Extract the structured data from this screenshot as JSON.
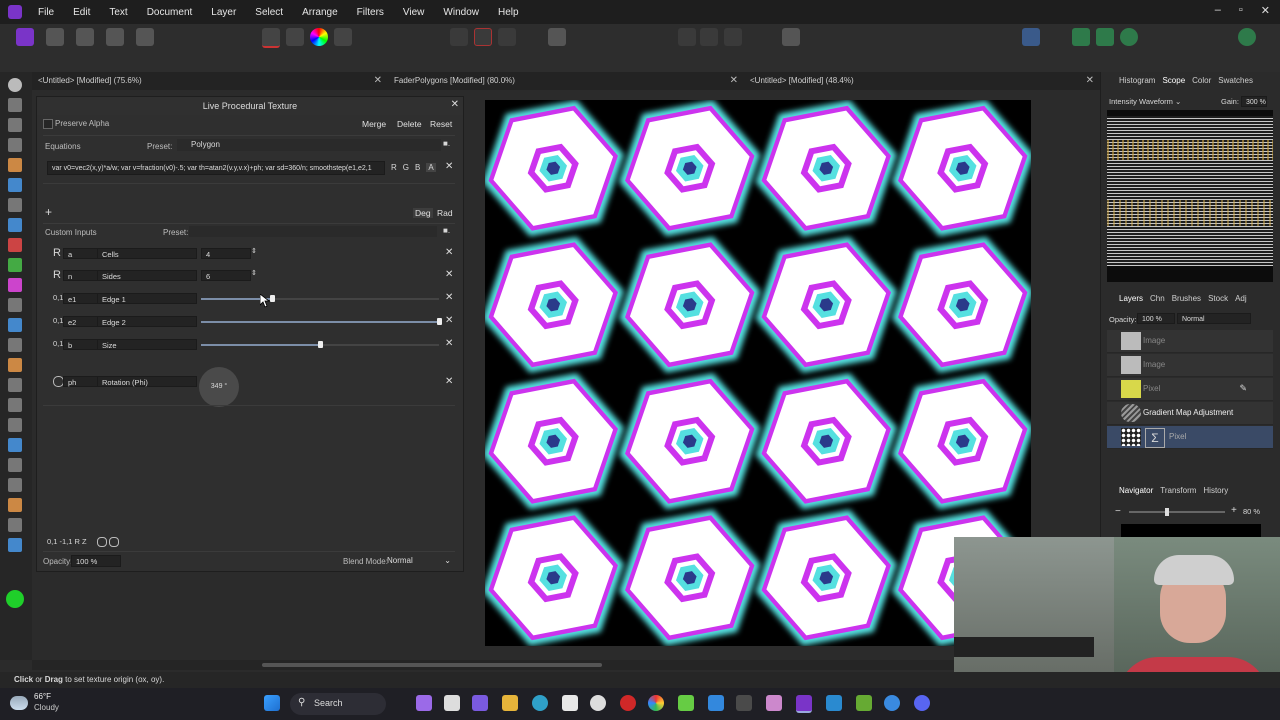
{
  "menu": [
    "File",
    "Edit",
    "Text",
    "Document",
    "Layer",
    "Select",
    "Arrange",
    "Filters",
    "View",
    "Window",
    "Help"
  ],
  "window_controls": {
    "minimize": "–",
    "maximize": "▫",
    "close": "✕"
  },
  "tabs": [
    {
      "label": "<Untitled> [Modified] (75.6%)"
    },
    {
      "label": "FaderPolygons [Modified] (80.0%)"
    },
    {
      "label": "<Untitled> [Modified] (48.4%)"
    }
  ],
  "panel": {
    "title": "Live Procedural Texture",
    "preserve_alpha": "Preserve Alpha",
    "merge": "Merge",
    "delete": "Delete",
    "reset": "Reset",
    "equations_label": "Equations",
    "preset_label": "Preset:",
    "preset_value": "Polygon",
    "equation": "var v0=vec2(x,y)*a/w; var v=fraction(v0)-.5; var th=atan2(v.y,v.x)+ph; var sd=360/n; smoothstep(e1,e2,1",
    "channels": [
      "R",
      "G",
      "B",
      "A"
    ],
    "add": "+",
    "deg": "Deg",
    "rad": "Rad",
    "custom_inputs": "Custom Inputs",
    "custom_preset_label": "Preset:",
    "inputs": [
      {
        "type": "R",
        "var": "a",
        "name": "Cells",
        "value": "4"
      },
      {
        "type": "R",
        "var": "n",
        "name": "Sides",
        "value": "6"
      },
      {
        "type": "0,1",
        "var": "e1",
        "name": "Edge 1",
        "level": 0.3
      },
      {
        "type": "0,1",
        "var": "e2",
        "name": "Edge 2",
        "level": 1.0
      },
      {
        "type": "0,1",
        "var": "b",
        "name": "Size",
        "level": 0.5
      }
    ],
    "rotation": {
      "var": "ph",
      "name": "Rotation (Phi)",
      "value": "349 °"
    },
    "bottom_icons": "0,1  -1,1  R  Z",
    "opacity_label": "Opacity:",
    "opacity_value": "100 %",
    "blend_label": "Blend Mode:",
    "blend_value": "Normal"
  },
  "right": {
    "tabs": [
      "Histogram",
      "Scope",
      "Color",
      "Swatches"
    ],
    "scope_mode": "Intensity Waveform",
    "gain_label": "Gain:",
    "gain_value": "300 %",
    "layer_tabs": [
      "Layers",
      "Chn",
      "Brushes",
      "Stock",
      "Adj"
    ],
    "opacity_label": "Opacity:",
    "opacity_value": "100 %",
    "blend": "Normal",
    "layers": [
      "Image",
      "Image",
      "Pixel",
      "Gradient Map Adjustment",
      "Pixel"
    ],
    "nav_tabs": [
      "Navigator",
      "Transform",
      "History"
    ],
    "zoom": "80 %"
  },
  "status": {
    "bold1": "Click",
    "or": " or ",
    "bold2": "Drag",
    "rest": " to set texture origin (ox, oy)."
  },
  "taskbar": {
    "temp": "66°F",
    "weather": "Cloudy",
    "search": "Search"
  },
  "colors": {
    "accent": "#7a34c8",
    "magenta": "#cc33ee",
    "cyan": "#55e0e0"
  }
}
